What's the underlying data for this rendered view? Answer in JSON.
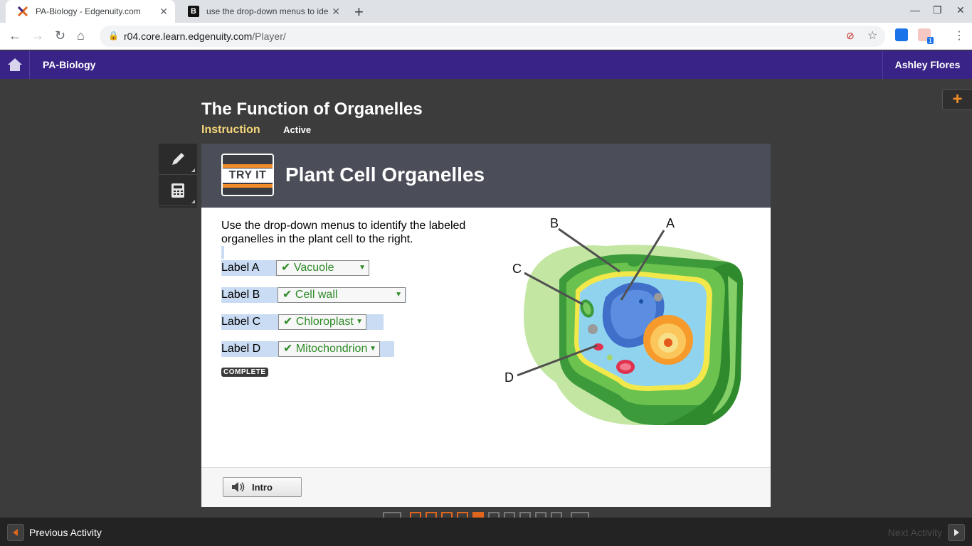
{
  "browser": {
    "tabs": [
      {
        "title": "PA-Biology - Edgenuity.com",
        "active": true
      },
      {
        "title": "use the drop-down menus to ide",
        "active": false
      }
    ],
    "url_domain": "r04.core.learn.edgenuity.com",
    "url_path": "/Player/",
    "extension_badge": "1"
  },
  "header": {
    "course": "PA-Biology",
    "user": "Ashley Flores"
  },
  "lesson": {
    "title": "The Function of Organelles",
    "activity": "Instruction",
    "status": "Active"
  },
  "content": {
    "badge": "TRY IT",
    "title": "Plant Cell Organelles",
    "instructions": "Use the drop-down menus to identify the labeled organelles in the plant cell to the right.",
    "questions": [
      {
        "label": "Label A",
        "answer": "✔ Vacuole"
      },
      {
        "label": "Label B",
        "answer": "✔ Cell wall"
      },
      {
        "label": "Label C",
        "answer": "✔ Chloroplast"
      },
      {
        "label": "Label D",
        "answer": "✔ Mitochondrion"
      }
    ],
    "complete_badge": "COMPLETE",
    "diagram_labels": [
      "A",
      "B",
      "C",
      "D"
    ],
    "intro_button": "Intro"
  },
  "footer": {
    "prev_label": "Previous Activity",
    "next_label": "Next Activity"
  },
  "colors": {
    "header_purple": "#3a2387",
    "accent_orange": "#e0661d",
    "correct_green": "#2e8b27"
  }
}
